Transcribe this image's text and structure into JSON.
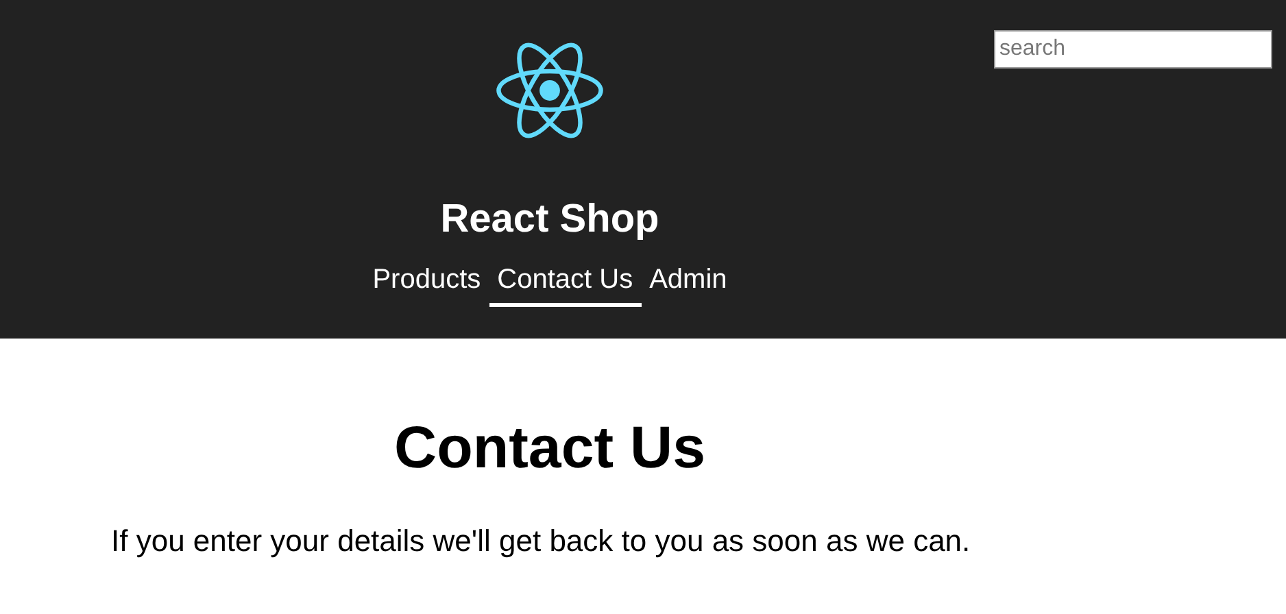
{
  "header": {
    "title": "React Shop",
    "search": {
      "placeholder": "search"
    },
    "nav": [
      {
        "label": "Products",
        "selected": false
      },
      {
        "label": "Contact Us",
        "selected": true
      },
      {
        "label": "Admin",
        "selected": false
      }
    ]
  },
  "page": {
    "heading": "Contact Us",
    "text": "If you enter your details we'll get back to you as soon as we can."
  }
}
